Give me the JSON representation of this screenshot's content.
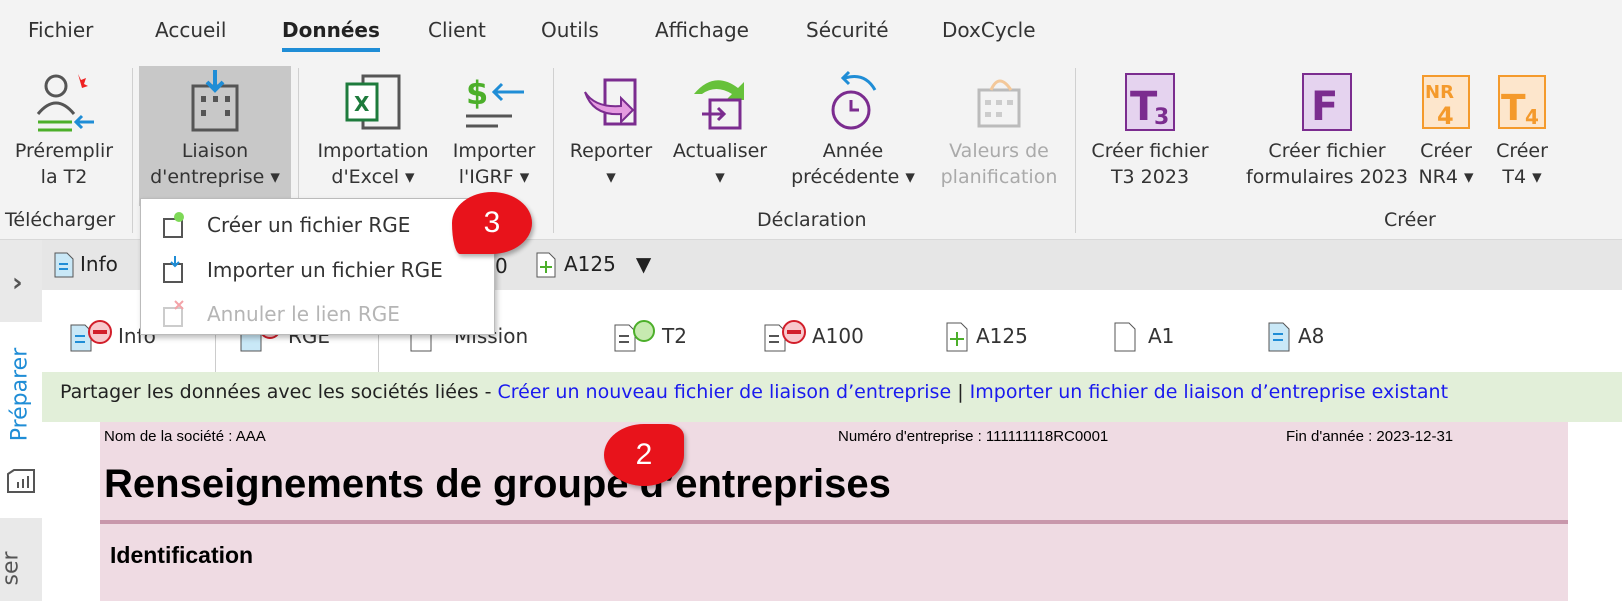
{
  "menubar": {
    "tabs": [
      "Fichier",
      "Accueil",
      "Données",
      "Client",
      "Outils",
      "Affichage",
      "Sécurité",
      "DoxCycle"
    ],
    "active": "Données"
  },
  "ribbon": {
    "buttons": [
      {
        "l1": "Préremplir",
        "l2": "la T2"
      },
      {
        "l1": "Liaison",
        "l2": "d'entreprise ▾"
      },
      {
        "l1": "Importation",
        "l2": "d'Excel ▾"
      },
      {
        "l1": "Importer",
        "l2": "l'IGRF ▾"
      },
      {
        "l1": "Reporter",
        "l2": "▾"
      },
      {
        "l1": "Actualiser",
        "l2": "▾"
      },
      {
        "l1": "Année",
        "l2": "précédente ▾"
      },
      {
        "l1": "Valeurs de",
        "l2": "planification"
      },
      {
        "l1": "Créer fichier",
        "l2": "T3 2023"
      },
      {
        "l1": "Créer fichier",
        "l2": "formulaires 2023"
      },
      {
        "l1": "Créer",
        "l2": "NR4 ▾"
      },
      {
        "l1": "Créer",
        "l2": "T4 ▾"
      }
    ],
    "groups": [
      "Télécharger",
      "Déclaration",
      "Créer"
    ]
  },
  "dropdown": {
    "items": [
      "Créer un fichier RGE",
      "Importer un fichier RGE",
      "Annuler le lien RGE"
    ]
  },
  "bar2": {
    "items": [
      "Info",
      "0",
      "A125"
    ],
    "expand": "›"
  },
  "doc_tabs": [
    "Info",
    "RGE",
    "Mission",
    "T2",
    "A100",
    "A125",
    "A1",
    "A8"
  ],
  "sidebar": {
    "active": "Préparer",
    "other": "ser"
  },
  "banner": {
    "text": "Partager les données avec les sociétés liées - ",
    "link1": "Créer un nouveau fichier de liaison d’entreprise",
    "sep": " | ",
    "link2": "Importer un fichier de liaison d’entreprise existant"
  },
  "form": {
    "company": "Nom de la société : AAA",
    "bn": "Numéro d'entreprise : 111111118RC0001",
    "yearend": "Fin d'année : 2023-12-31",
    "title": "Renseignements de groupe d’entreprises",
    "section": "Identification"
  },
  "callouts": [
    "3",
    "2"
  ],
  "colors": {
    "accent": "#1f8dd6",
    "purple": "#7b2c8f",
    "orange": "#f49a2c",
    "callout": "#e8131b",
    "banner": "#e2efd9",
    "form": "#efdbe3"
  }
}
